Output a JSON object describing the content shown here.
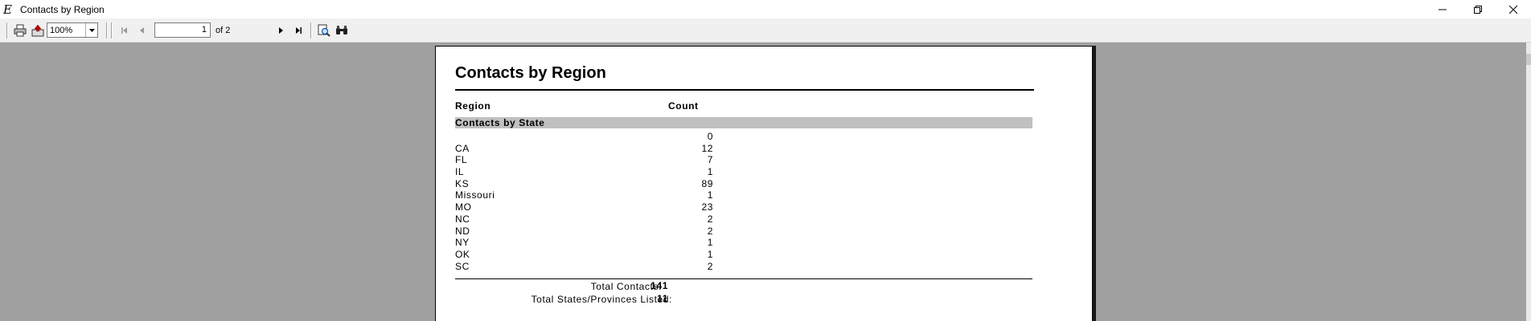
{
  "window": {
    "title": "Contacts by Region",
    "app_icon_glyph": "E"
  },
  "toolbar": {
    "zoom_value": "100%",
    "page_current": "1",
    "page_of": "of 2",
    "icons": [
      "printer-icon",
      "export-icon",
      "first-page-icon",
      "prev-page-icon",
      "next-page-icon",
      "last-page-icon",
      "zoom-page-icon",
      "find-icon"
    ]
  },
  "report": {
    "title": "Contacts by Region",
    "col_region": "Region",
    "col_count": "Count",
    "group_label": "Contacts by State",
    "rows": [
      {
        "region": "",
        "count": "0"
      },
      {
        "region": "CA",
        "count": "12"
      },
      {
        "region": "FL",
        "count": "7"
      },
      {
        "region": "IL",
        "count": "1"
      },
      {
        "region": "KS",
        "count": "89"
      },
      {
        "region": "Missouri",
        "count": "1"
      },
      {
        "region": "MO",
        "count": "23"
      },
      {
        "region": "NC",
        "count": "2"
      },
      {
        "region": "ND",
        "count": "2"
      },
      {
        "region": "NY",
        "count": "1"
      },
      {
        "region": "OK",
        "count": "1"
      },
      {
        "region": "SC",
        "count": "2"
      }
    ],
    "total_contacts_label": "Total Contacts:",
    "total_contacts_value": "141",
    "total_states_label": "Total States/Provinces Listed:",
    "total_states_value": "11"
  },
  "colors": {
    "viewer_background": "#a0a0a0",
    "group_band": "#c0c0c0",
    "toolbar": "#f0f0f0"
  }
}
